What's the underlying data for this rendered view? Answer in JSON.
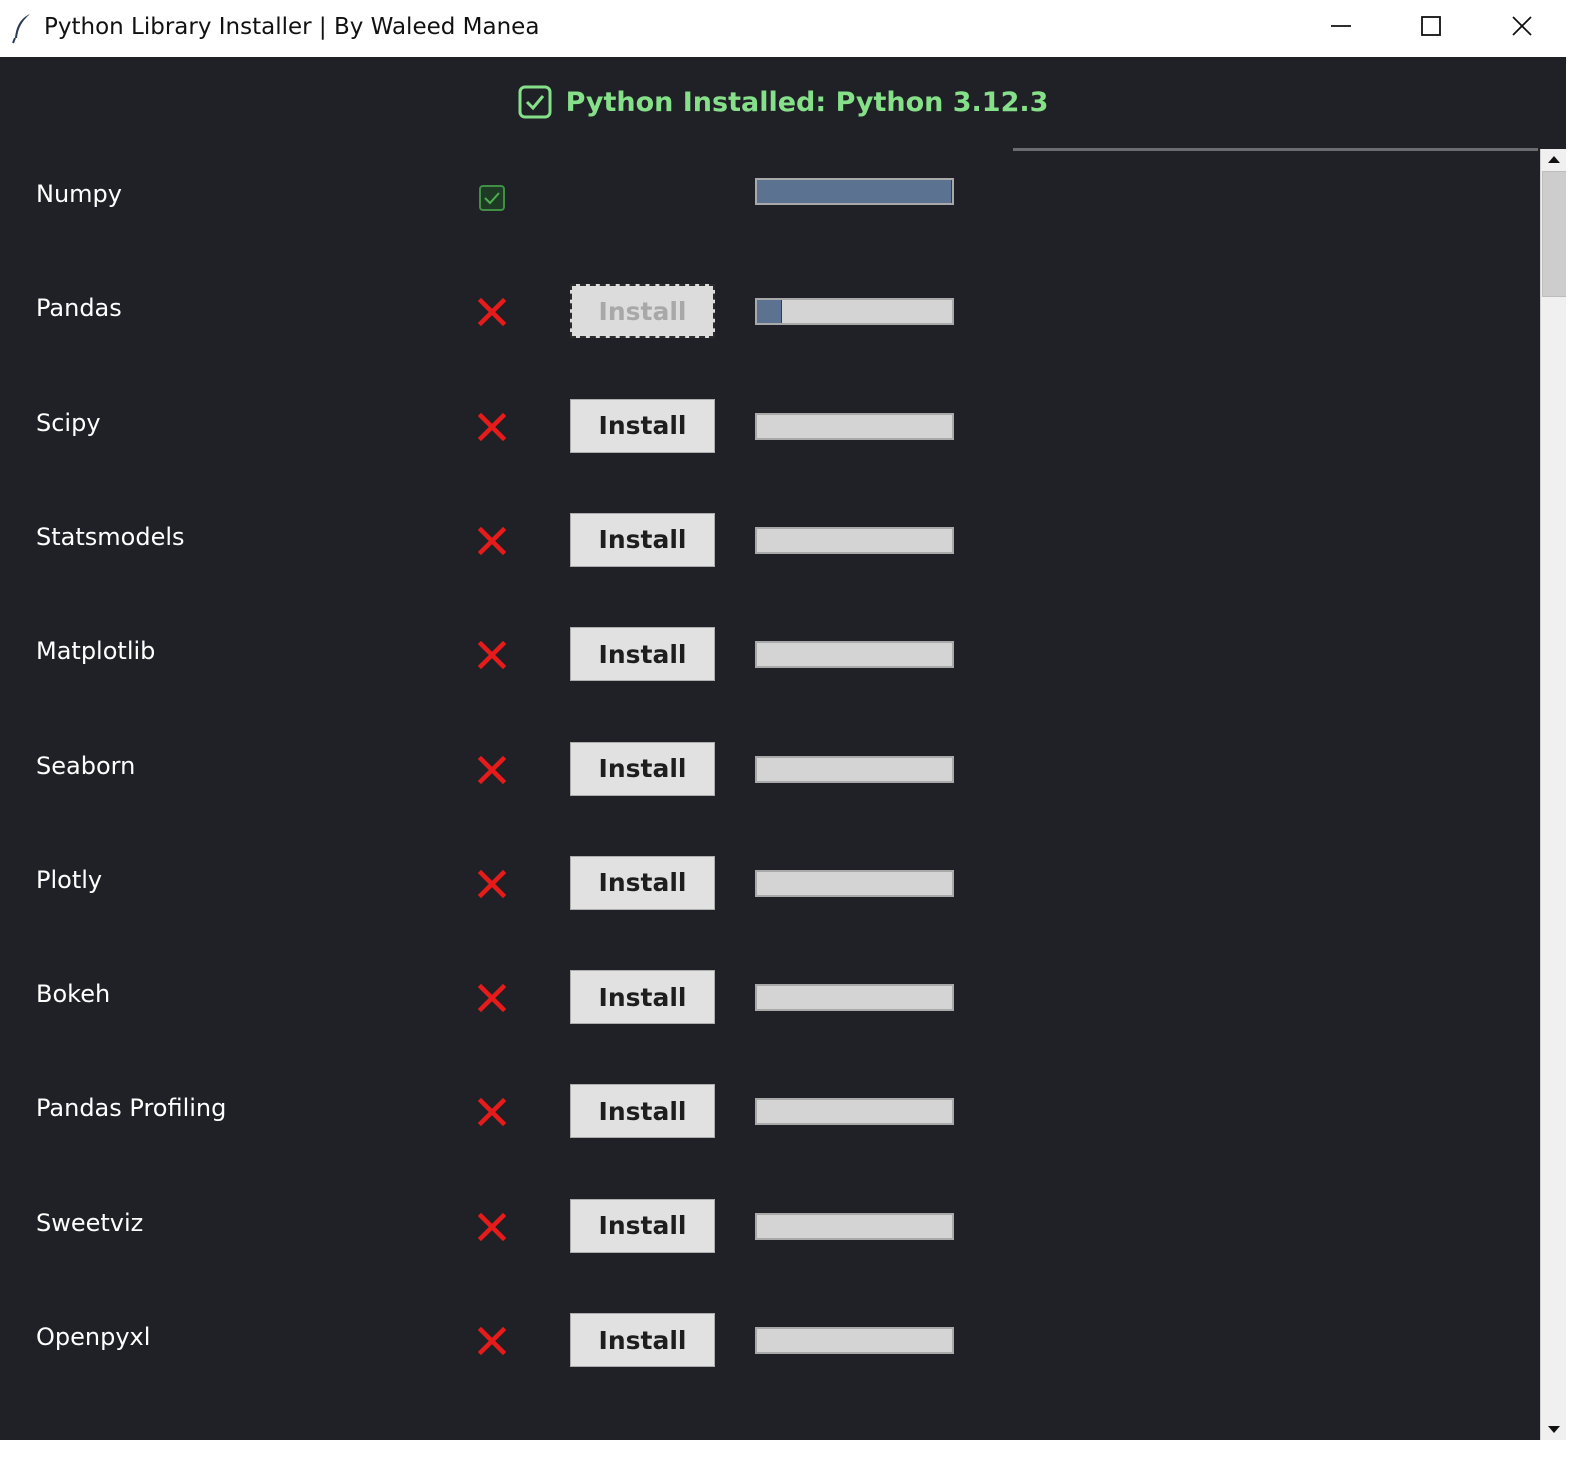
{
  "window": {
    "title": "Python Library Installer | By Waleed Manea",
    "app_icon": "feather-icon",
    "controls": [
      "minimize-icon",
      "maximize-icon",
      "close-icon"
    ]
  },
  "header": {
    "status_icon": "check-box-icon",
    "status_text": "Python Installed: Python 3.12.3",
    "status_color": "#85e089"
  },
  "colors": {
    "background": "#202126",
    "installed": "#4caf50",
    "missing": "#e81b1b",
    "progress_fill": "#5b7390"
  },
  "libraries": [
    {
      "name": "Numpy",
      "status": "installed",
      "button": "",
      "progress": 1.0
    },
    {
      "name": "Pandas",
      "status": "missing",
      "button": "Install",
      "button_state": "disabled",
      "progress": 0.13
    },
    {
      "name": "Scipy",
      "status": "missing",
      "button": "Install",
      "progress": 0
    },
    {
      "name": "Statsmodels",
      "status": "missing",
      "button": "Install",
      "progress": 0
    },
    {
      "name": "Matplotlib",
      "status": "missing",
      "button": "Install",
      "progress": 0
    },
    {
      "name": "Seaborn",
      "status": "missing",
      "button": "Install",
      "progress": 0
    },
    {
      "name": "Plotly",
      "status": "missing",
      "button": "Install",
      "progress": 0
    },
    {
      "name": "Bokeh",
      "status": "missing",
      "button": "Install",
      "progress": 0
    },
    {
      "name": "Pandas Profiling",
      "status": "missing",
      "button": "Install",
      "progress": 0
    },
    {
      "name": "Sweetviz",
      "status": "missing",
      "button": "Install",
      "progress": 0
    },
    {
      "name": "Openpyxl",
      "status": "missing",
      "button": "Install",
      "progress": 0
    }
  ]
}
